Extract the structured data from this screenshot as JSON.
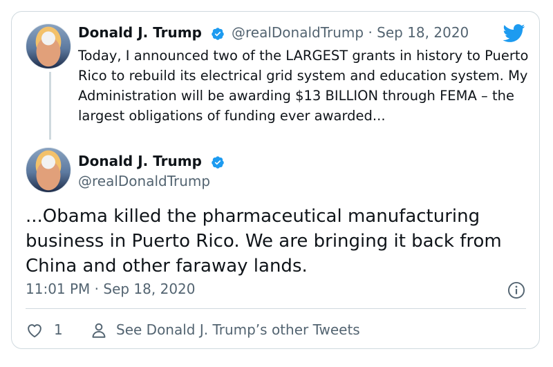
{
  "tweet1": {
    "name": "Donald J. Trump",
    "handle": "@realDonaldTrump",
    "date": "Sep 18, 2020",
    "separator": "·",
    "text": "Today, I announced two of the LARGEST grants in history to Puerto Rico to rebuild its electrical grid system and education system. My Administration will be awarding $13 BILLION through FEMA – the largest obligations of funding ever awarded..."
  },
  "tweet2": {
    "name": "Donald J. Trump",
    "handle": "@realDonaldTrump",
    "text": "...Obama killed the pharmaceutical manufacturing business in Puerto Rico. We are bringing it back from China and other faraway lands.",
    "timestamp": "11:01 PM · Sep 18, 2020"
  },
  "footer": {
    "like_count": "1",
    "other_tweets_label": "See Donald J. Trump’s other Tweets"
  },
  "icons": {
    "verified": "verified-badge-icon",
    "twitter": "twitter-bird-icon",
    "info": "info-icon",
    "heart": "heart-icon",
    "person": "person-icon"
  },
  "colors": {
    "brand": "#1d9bf0",
    "text": "#0f1419",
    "secondary": "#536471",
    "border": "#cfd9de"
  }
}
